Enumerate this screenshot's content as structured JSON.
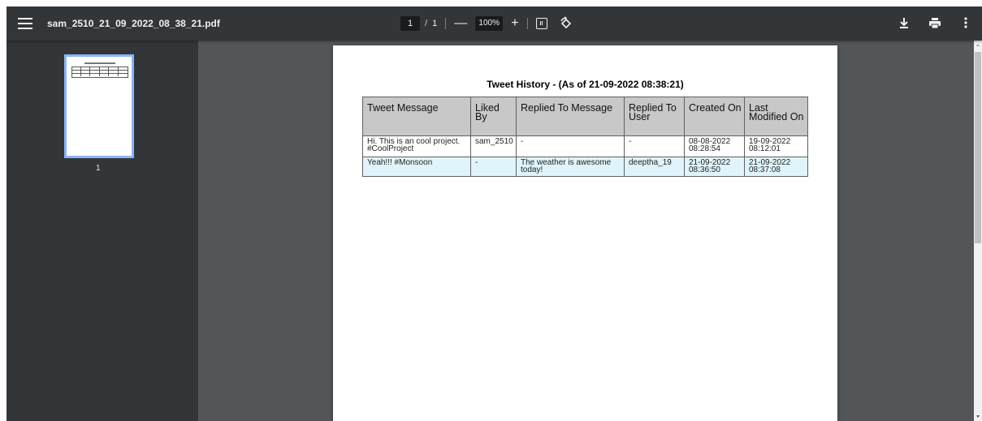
{
  "toolbar": {
    "menu_icon": "hamburger-menu-icon",
    "file_title": "sam_2510_21_09_2022_08_38_21.pdf",
    "page_current": "1",
    "page_separator": "/",
    "page_total": "1",
    "zoom_out_label": "—",
    "zoom_value": "100%",
    "zoom_in_label": "+",
    "fit_icon": "fit-to-page-icon",
    "rotate_icon": "rotate-counterclockwise-icon",
    "download_icon": "download-icon",
    "print_icon": "print-icon",
    "more_icon": "more-vertical-icon"
  },
  "sidebar": {
    "thumbnails": [
      {
        "label": "1",
        "selected": true
      }
    ]
  },
  "document": {
    "title": "Tweet History - (As of 21-09-2022 08:38:21)",
    "table": {
      "headers": [
        "Tweet Message",
        "Liked By",
        "Replied To Message",
        "Replied To User",
        "Created On",
        "Last Modified On"
      ],
      "rows": [
        [
          "Hi. This is an cool project. #CoolProject",
          "sam_2510",
          "-",
          "-",
          "08-08-2022 08:28:54",
          "19-09-2022 08:12:01"
        ],
        [
          "Yeah!!! #Monsoon",
          "-",
          "The weather is awesome today!",
          "deeptha_19",
          "21-09-2022 08:36:50",
          "21-09-2022 08:37:08"
        ]
      ]
    }
  },
  "colors": {
    "toolbar_bg": "#323639",
    "viewer_bg": "#525659",
    "thumbnail_border": "#8ab4f8",
    "header_bg": "#c8c8c8",
    "alt_row_bg": "#dff5fb"
  }
}
